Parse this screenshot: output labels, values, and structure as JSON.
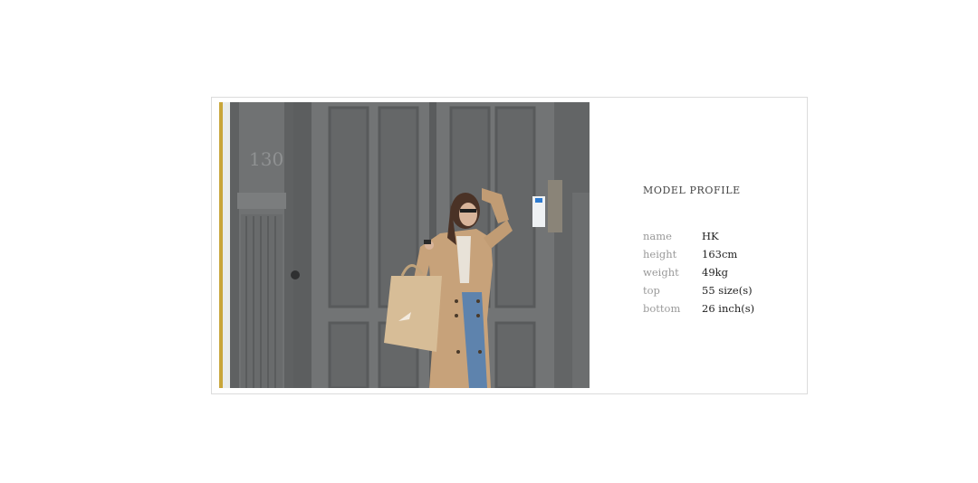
{
  "photo": {
    "door_number": "130"
  },
  "profile": {
    "title": "MODEL PROFILE",
    "rows": [
      {
        "label": "name",
        "value": "HK"
      },
      {
        "label": "height",
        "value": "163cm"
      },
      {
        "label": "weight",
        "value": "49kg"
      },
      {
        "label": "top",
        "value": "55 size(s)"
      },
      {
        "label": "bottom",
        "value": "26 inch(s)"
      }
    ]
  },
  "colors": {
    "border": "#dcdcdc",
    "label_text": "#9a9a9a",
    "value_text": "#222222",
    "door_gray": "#6b6d6e",
    "coat_tan": "#c9a57c",
    "bag_tan": "#d9bf9a",
    "jeans_blue": "#5b7fa8"
  }
}
